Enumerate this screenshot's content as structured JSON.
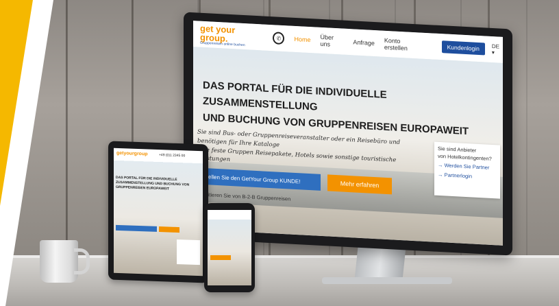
{
  "imac": {
    "nav": {
      "logo_word": "get your group.",
      "logo_sub": "Gruppenreisen online buchen",
      "items": [
        "Home",
        "Über uns",
        "Anfrage",
        "Konto erstellen"
      ],
      "login": "Kundenlogin",
      "lang": "DE ▾"
    },
    "headline_line1": "DAS PORTAL FÜR DIE INDIVIDUELLE ZUSAMMENSTELLUNG",
    "headline_line2": "UND BUCHUNG VON GRUPPENREISEN EUROPAWEIT",
    "tagline_line1": "Sie sind Bus- oder Gruppenreiseveranstalter oder ein Reisebüro und benötigen für Ihre Kataloge",
    "tagline_line2": "Ihre feste Gruppen Reisepakete, Hotels sowie sonstige touristische Leistungen",
    "cta_primary": "Bestellen Sie den GetYour Group KUNDE!",
    "cta_secondary": "Mehr erfahren",
    "subline": "Profitieren Sie von B-2-B Gruppenreisen",
    "side_box": {
      "line1": "Sie sind Anbieter",
      "line2": "von Hotelkontingenten?",
      "link1": "→ Werden Sie Partner",
      "link2": "→ Partnerlogin"
    }
  },
  "tablet": {
    "logo": "getyourgroup",
    "phone": "+49 (0)1 2345 00",
    "headline": "DAS PORTAL FÜR DIE INDIVIDUELLE ZUSAMMENSTELLUNG UND BUCHUNG VON GRUPPENREISEN EUROPAWEIT"
  },
  "colors": {
    "brand_orange": "#f39200",
    "brand_blue": "#1e4e9e",
    "accent_yellow": "#f5b800"
  }
}
